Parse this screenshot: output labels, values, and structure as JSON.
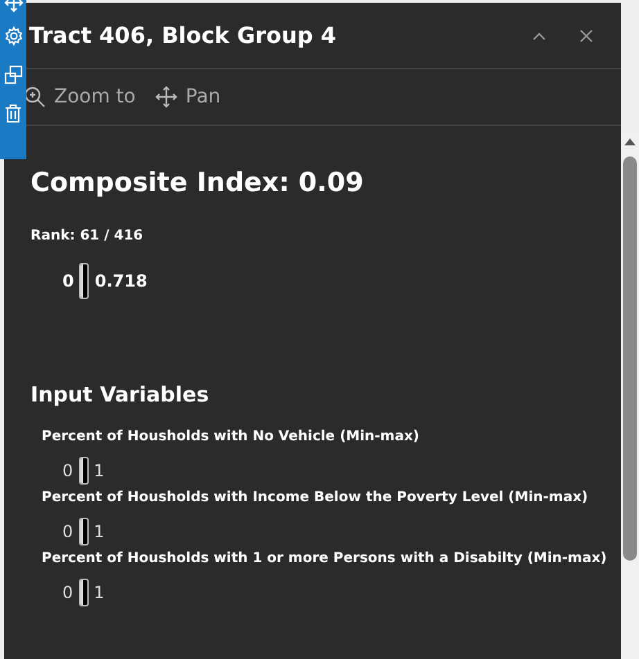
{
  "popup": {
    "title": "Tract 406, Block Group 4",
    "actions": [
      {
        "kind": "zoom",
        "label": "Zoom to"
      },
      {
        "kind": "pan",
        "label": "Pan"
      }
    ],
    "heading": "Composite Index: 0.09",
    "rank": "Rank: 61 / 416",
    "gauge": {
      "min": "0",
      "max": "0.718"
    },
    "section_title": "Input Variables",
    "variables": [
      {
        "label": "Percent of Housholds with No Vehicle (Min-max)",
        "min": "0",
        "max": "1"
      },
      {
        "label": "Percent of Housholds with Income Below the Poverty Level (Min-max)",
        "min": "0",
        "max": "1"
      },
      {
        "label": "Percent of Housholds with 1 or more Persons with a Disabilty (Min-max)",
        "min": "0",
        "max": "1"
      }
    ]
  }
}
